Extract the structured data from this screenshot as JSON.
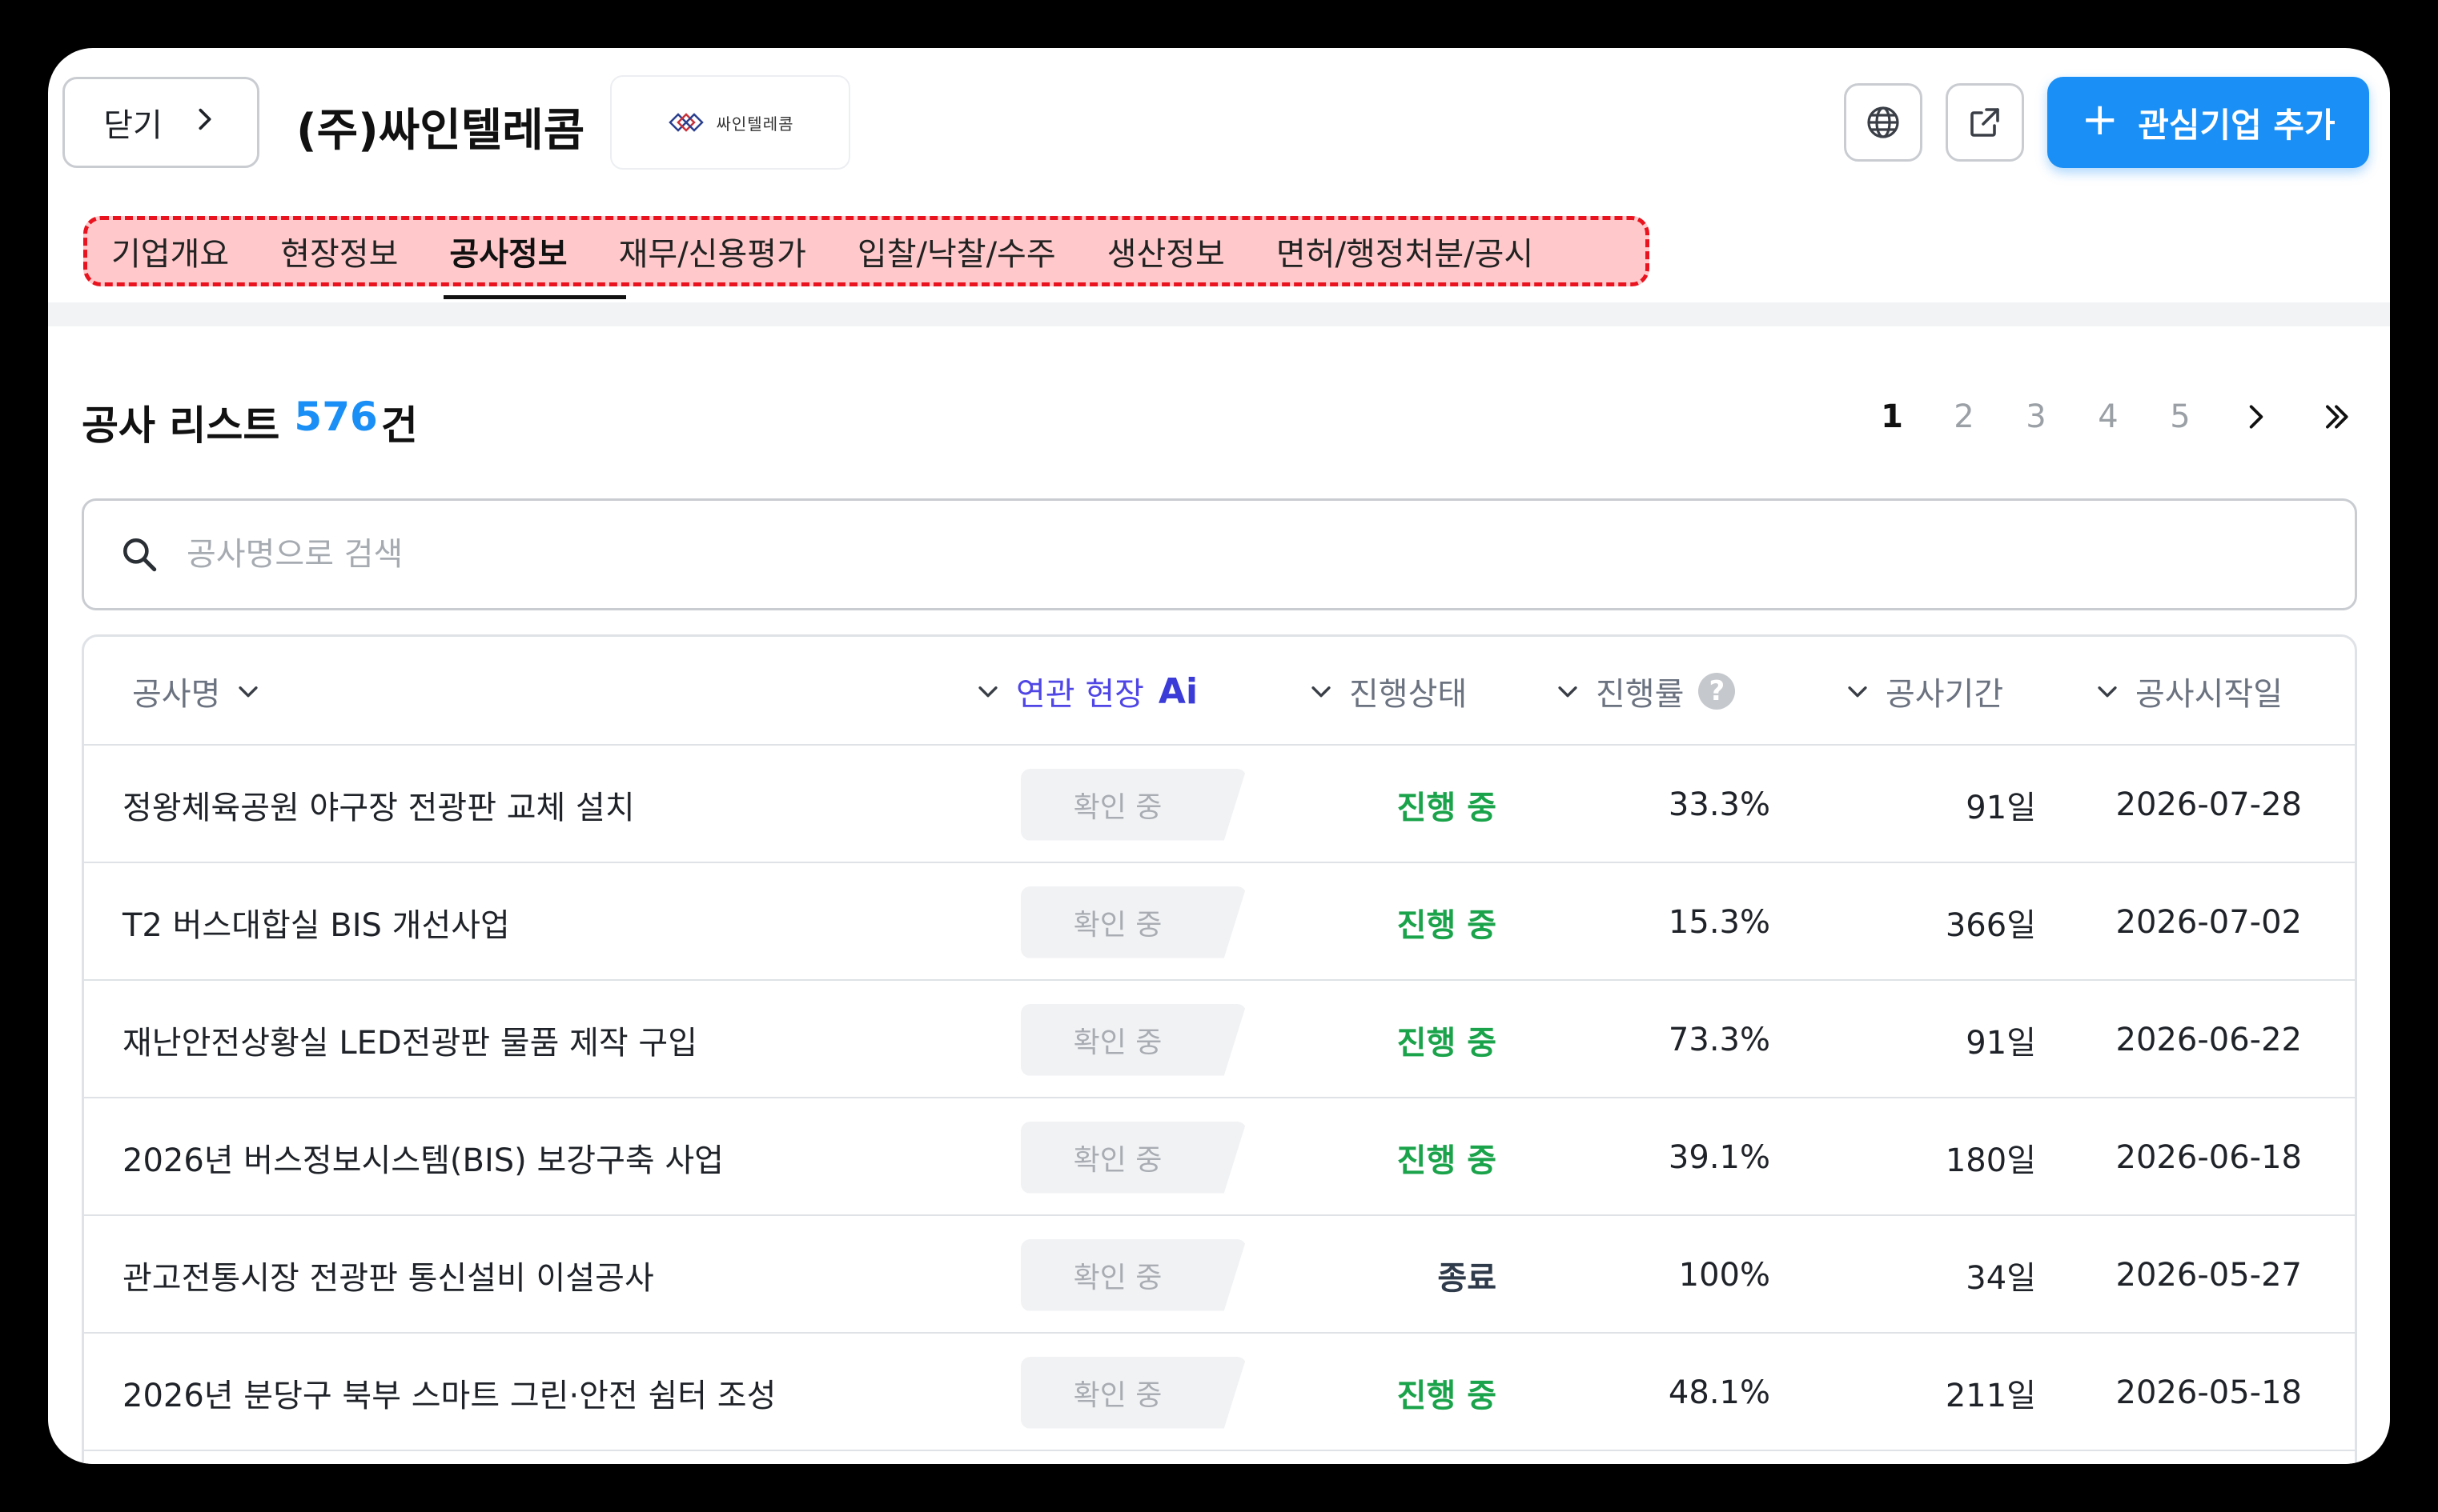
{
  "header": {
    "close_label": "닫기",
    "company_name": "(주)싸인텔레콤",
    "logo_text": "싸인텔레콤",
    "add_button_label": "관심기업 추가",
    "accent_color": "#1a8ff5"
  },
  "tabs": [
    {
      "label": "기업개요",
      "active": false
    },
    {
      "label": "현장정보",
      "active": false
    },
    {
      "label": "공사정보",
      "active": true
    },
    {
      "label": "재무/신용평가",
      "active": false
    },
    {
      "label": "입찰/낙찰/수주",
      "active": false
    },
    {
      "label": "생산정보",
      "active": false
    },
    {
      "label": "면허/행정처분/공시",
      "active": false
    }
  ],
  "list": {
    "title": "공사 리스트",
    "count": "576",
    "count_suffix": "건"
  },
  "pagination": {
    "pages": [
      "1",
      "2",
      "3",
      "4",
      "5"
    ],
    "current": "1"
  },
  "search": {
    "placeholder": "공사명으로 검색",
    "value": ""
  },
  "table": {
    "columns": {
      "name": "공사명",
      "related": "연관 현장",
      "related_badge": "Ai",
      "status": "진행상태",
      "rate": "진행률",
      "rate_help": "?",
      "period": "공사기간",
      "start": "공사시작일"
    },
    "rows": [
      {
        "name": "정왕체육공원 야구장 전광판 교체 설치",
        "related": "확인 중",
        "status": "진행 중",
        "rate": "33.3%",
        "period": "91일",
        "start": "2026-07-28"
      },
      {
        "name": "T2 버스대합실 BIS 개선사업",
        "related": "확인 중",
        "status": "진행 중",
        "rate": "15.3%",
        "period": "366일",
        "start": "2026-07-02"
      },
      {
        "name": "재난안전상황실 LED전광판 물품 제작 구입",
        "related": "확인 중",
        "status": "진행 중",
        "rate": "73.3%",
        "period": "91일",
        "start": "2026-06-22"
      },
      {
        "name": "2026년 버스정보시스템(BIS) 보강구축 사업",
        "related": "확인 중",
        "status": "진행 중",
        "rate": "39.1%",
        "period": "180일",
        "start": "2026-06-18"
      },
      {
        "name": "관고전통시장 전광판 통신설비 이설공사",
        "related": "확인 중",
        "status": "종료",
        "rate": "100%",
        "period": "34일",
        "start": "2026-05-27"
      },
      {
        "name": "2026년 분당구 북부 스마트 그린·안전 쉼터 조성",
        "related": "확인 중",
        "status": "진행 중",
        "rate": "48.1%",
        "period": "211일",
        "start": "2026-05-18"
      }
    ],
    "status_colors": {
      "진행 중": "#1aa34a",
      "종료": "#2f3a4a"
    }
  }
}
